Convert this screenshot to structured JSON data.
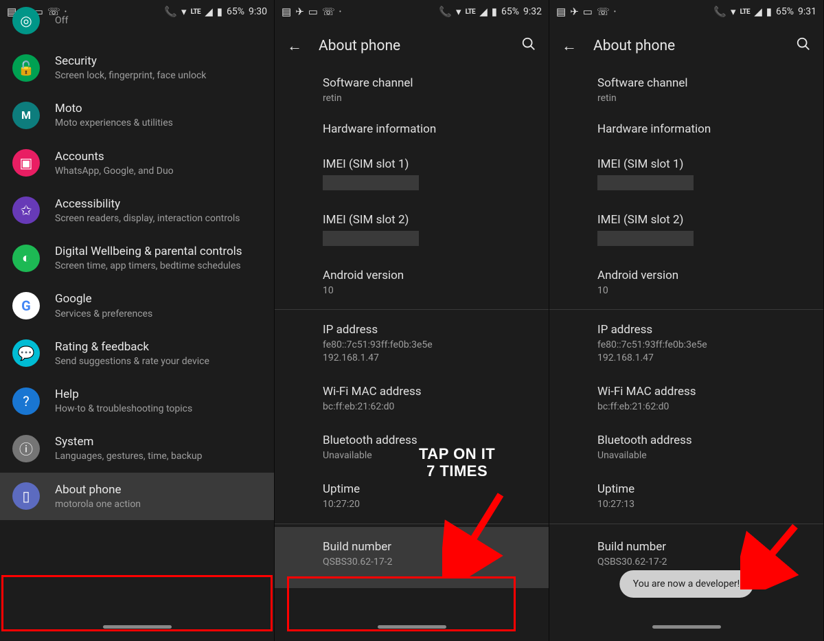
{
  "status": {
    "battery": "65%",
    "lte": "LTE"
  },
  "screen1": {
    "time": "9:30",
    "items": [
      {
        "title": "",
        "sub": "Off",
        "icon": "teal"
      },
      {
        "title": "Security",
        "sub": "Screen lock, fingerprint, face unlock",
        "icon": "green"
      },
      {
        "title": "Moto",
        "sub": "Moto experiences & utilities",
        "icon": "moto"
      },
      {
        "title": "Accounts",
        "sub": "WhatsApp, Google, and Duo",
        "icon": "pink"
      },
      {
        "title": "Accessibility",
        "sub": "Screen readers, display, interaction controls",
        "icon": "purple"
      },
      {
        "title": "Digital Wellbeing & parental controls",
        "sub": "Screen time, app timers, bedtime schedules",
        "icon": "green2"
      },
      {
        "title": "Google",
        "sub": "Services & preferences",
        "icon": "google"
      },
      {
        "title": "Rating & feedback",
        "sub": "Send suggestions & rate your device",
        "icon": "cyan"
      },
      {
        "title": "Help",
        "sub": "How-to & troubleshooting topics",
        "icon": "blue"
      },
      {
        "title": "System",
        "sub": "Languages, gestures, time, backup",
        "icon": "grey"
      },
      {
        "title": "About phone",
        "sub": "motorola one action",
        "icon": "indigo"
      }
    ]
  },
  "screen2": {
    "time": "9:32",
    "title": "About phone",
    "items": {
      "software_channel": {
        "title": "Software channel",
        "value": "retin"
      },
      "hardware_info": {
        "title": "Hardware information"
      },
      "imei1": {
        "title": "IMEI (SIM slot 1)"
      },
      "imei2": {
        "title": "IMEI (SIM slot 2)"
      },
      "android": {
        "title": "Android version",
        "value": "10"
      },
      "ip": {
        "title": "IP address",
        "value": "fe80::7c51:93ff:fe0b:3e5e\n192.168.1.47"
      },
      "wifi_mac": {
        "title": "Wi-Fi MAC address",
        "value": "bc:ff:eb:21:62:d0"
      },
      "bt": {
        "title": "Bluetooth address",
        "value": "Unavailable"
      },
      "uptime": {
        "title": "Uptime",
        "value": "10:27:20"
      },
      "build": {
        "title": "Build number",
        "value": "QSBS30.62-17-2"
      }
    },
    "annotation": "TAP ON IT\n7 TIMES"
  },
  "screen3": {
    "time": "9:31",
    "title": "About phone",
    "items": {
      "software_channel": {
        "title": "Software channel",
        "value": "retin"
      },
      "hardware_info": {
        "title": "Hardware information"
      },
      "imei1": {
        "title": "IMEI (SIM slot 1)"
      },
      "imei2": {
        "title": "IMEI (SIM slot 2)"
      },
      "android": {
        "title": "Android version",
        "value": "10"
      },
      "ip": {
        "title": "IP address",
        "value": "fe80::7c51:93ff:fe0b:3e5e\n192.168.1.47"
      },
      "wifi_mac": {
        "title": "Wi-Fi MAC address",
        "value": "bc:ff:eb:21:62:d0"
      },
      "bt": {
        "title": "Bluetooth address",
        "value": "Unavailable"
      },
      "uptime": {
        "title": "Uptime",
        "value": "10:27:13"
      },
      "build": {
        "title": "Build number",
        "value": "QSBS30.62-17-2"
      }
    },
    "toast": "You are now a developer!"
  }
}
